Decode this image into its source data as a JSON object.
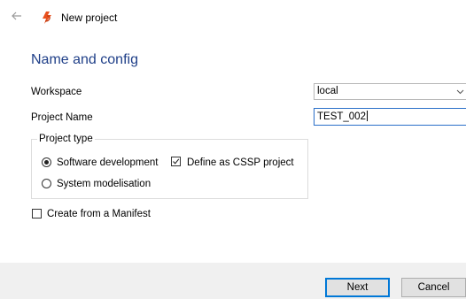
{
  "window": {
    "title": "New project",
    "back_icon": "back-arrow-icon",
    "app_icon": "app-logo-icon"
  },
  "page": {
    "heading": "Name and config"
  },
  "form": {
    "workspace": {
      "label": "Workspace",
      "value": "local",
      "icon": "chevron-down-icon"
    },
    "project_name": {
      "label": "Project Name",
      "value": "TEST_002"
    },
    "project_type": {
      "legend": "Project type",
      "options": [
        {
          "label": "Software development",
          "selected": true
        },
        {
          "label": "System modelisation",
          "selected": false
        }
      ],
      "cssp": {
        "label": "Define as CSSP project",
        "checked": true
      }
    },
    "manifest": {
      "label": "Create from a Manifest",
      "checked": false
    }
  },
  "footer": {
    "next_label": "Next",
    "cancel_label": "Cancel"
  },
  "colors": {
    "heading": "#1f3f88",
    "accent": "#0078d7",
    "footer_bg": "#f0f0f0",
    "logo": "#e8501e"
  }
}
